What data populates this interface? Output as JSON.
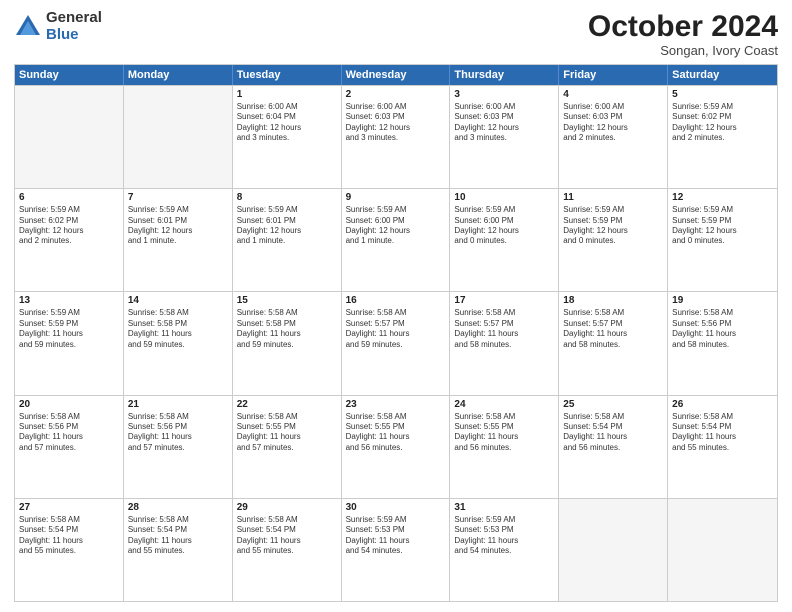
{
  "logo": {
    "general": "General",
    "blue": "Blue"
  },
  "title": "October 2024",
  "location": "Songan, Ivory Coast",
  "days": [
    "Sunday",
    "Monday",
    "Tuesday",
    "Wednesday",
    "Thursday",
    "Friday",
    "Saturday"
  ],
  "weeks": [
    [
      {
        "day": "",
        "lines": []
      },
      {
        "day": "",
        "lines": []
      },
      {
        "day": "1",
        "lines": [
          "Sunrise: 6:00 AM",
          "Sunset: 6:04 PM",
          "Daylight: 12 hours",
          "and 3 minutes."
        ]
      },
      {
        "day": "2",
        "lines": [
          "Sunrise: 6:00 AM",
          "Sunset: 6:03 PM",
          "Daylight: 12 hours",
          "and 3 minutes."
        ]
      },
      {
        "day": "3",
        "lines": [
          "Sunrise: 6:00 AM",
          "Sunset: 6:03 PM",
          "Daylight: 12 hours",
          "and 3 minutes."
        ]
      },
      {
        "day": "4",
        "lines": [
          "Sunrise: 6:00 AM",
          "Sunset: 6:03 PM",
          "Daylight: 12 hours",
          "and 2 minutes."
        ]
      },
      {
        "day": "5",
        "lines": [
          "Sunrise: 5:59 AM",
          "Sunset: 6:02 PM",
          "Daylight: 12 hours",
          "and 2 minutes."
        ]
      }
    ],
    [
      {
        "day": "6",
        "lines": [
          "Sunrise: 5:59 AM",
          "Sunset: 6:02 PM",
          "Daylight: 12 hours",
          "and 2 minutes."
        ]
      },
      {
        "day": "7",
        "lines": [
          "Sunrise: 5:59 AM",
          "Sunset: 6:01 PM",
          "Daylight: 12 hours",
          "and 1 minute."
        ]
      },
      {
        "day": "8",
        "lines": [
          "Sunrise: 5:59 AM",
          "Sunset: 6:01 PM",
          "Daylight: 12 hours",
          "and 1 minute."
        ]
      },
      {
        "day": "9",
        "lines": [
          "Sunrise: 5:59 AM",
          "Sunset: 6:00 PM",
          "Daylight: 12 hours",
          "and 1 minute."
        ]
      },
      {
        "day": "10",
        "lines": [
          "Sunrise: 5:59 AM",
          "Sunset: 6:00 PM",
          "Daylight: 12 hours",
          "and 0 minutes."
        ]
      },
      {
        "day": "11",
        "lines": [
          "Sunrise: 5:59 AM",
          "Sunset: 5:59 PM",
          "Daylight: 12 hours",
          "and 0 minutes."
        ]
      },
      {
        "day": "12",
        "lines": [
          "Sunrise: 5:59 AM",
          "Sunset: 5:59 PM",
          "Daylight: 12 hours",
          "and 0 minutes."
        ]
      }
    ],
    [
      {
        "day": "13",
        "lines": [
          "Sunrise: 5:59 AM",
          "Sunset: 5:59 PM",
          "Daylight: 11 hours",
          "and 59 minutes."
        ]
      },
      {
        "day": "14",
        "lines": [
          "Sunrise: 5:58 AM",
          "Sunset: 5:58 PM",
          "Daylight: 11 hours",
          "and 59 minutes."
        ]
      },
      {
        "day": "15",
        "lines": [
          "Sunrise: 5:58 AM",
          "Sunset: 5:58 PM",
          "Daylight: 11 hours",
          "and 59 minutes."
        ]
      },
      {
        "day": "16",
        "lines": [
          "Sunrise: 5:58 AM",
          "Sunset: 5:57 PM",
          "Daylight: 11 hours",
          "and 59 minutes."
        ]
      },
      {
        "day": "17",
        "lines": [
          "Sunrise: 5:58 AM",
          "Sunset: 5:57 PM",
          "Daylight: 11 hours",
          "and 58 minutes."
        ]
      },
      {
        "day": "18",
        "lines": [
          "Sunrise: 5:58 AM",
          "Sunset: 5:57 PM",
          "Daylight: 11 hours",
          "and 58 minutes."
        ]
      },
      {
        "day": "19",
        "lines": [
          "Sunrise: 5:58 AM",
          "Sunset: 5:56 PM",
          "Daylight: 11 hours",
          "and 58 minutes."
        ]
      }
    ],
    [
      {
        "day": "20",
        "lines": [
          "Sunrise: 5:58 AM",
          "Sunset: 5:56 PM",
          "Daylight: 11 hours",
          "and 57 minutes."
        ]
      },
      {
        "day": "21",
        "lines": [
          "Sunrise: 5:58 AM",
          "Sunset: 5:56 PM",
          "Daylight: 11 hours",
          "and 57 minutes."
        ]
      },
      {
        "day": "22",
        "lines": [
          "Sunrise: 5:58 AM",
          "Sunset: 5:55 PM",
          "Daylight: 11 hours",
          "and 57 minutes."
        ]
      },
      {
        "day": "23",
        "lines": [
          "Sunrise: 5:58 AM",
          "Sunset: 5:55 PM",
          "Daylight: 11 hours",
          "and 56 minutes."
        ]
      },
      {
        "day": "24",
        "lines": [
          "Sunrise: 5:58 AM",
          "Sunset: 5:55 PM",
          "Daylight: 11 hours",
          "and 56 minutes."
        ]
      },
      {
        "day": "25",
        "lines": [
          "Sunrise: 5:58 AM",
          "Sunset: 5:54 PM",
          "Daylight: 11 hours",
          "and 56 minutes."
        ]
      },
      {
        "day": "26",
        "lines": [
          "Sunrise: 5:58 AM",
          "Sunset: 5:54 PM",
          "Daylight: 11 hours",
          "and 55 minutes."
        ]
      }
    ],
    [
      {
        "day": "27",
        "lines": [
          "Sunrise: 5:58 AM",
          "Sunset: 5:54 PM",
          "Daylight: 11 hours",
          "and 55 minutes."
        ]
      },
      {
        "day": "28",
        "lines": [
          "Sunrise: 5:58 AM",
          "Sunset: 5:54 PM",
          "Daylight: 11 hours",
          "and 55 minutes."
        ]
      },
      {
        "day": "29",
        "lines": [
          "Sunrise: 5:58 AM",
          "Sunset: 5:54 PM",
          "Daylight: 11 hours",
          "and 55 minutes."
        ]
      },
      {
        "day": "30",
        "lines": [
          "Sunrise: 5:59 AM",
          "Sunset: 5:53 PM",
          "Daylight: 11 hours",
          "and 54 minutes."
        ]
      },
      {
        "day": "31",
        "lines": [
          "Sunrise: 5:59 AM",
          "Sunset: 5:53 PM",
          "Daylight: 11 hours",
          "and 54 minutes."
        ]
      },
      {
        "day": "",
        "lines": []
      },
      {
        "day": "",
        "lines": []
      }
    ]
  ]
}
